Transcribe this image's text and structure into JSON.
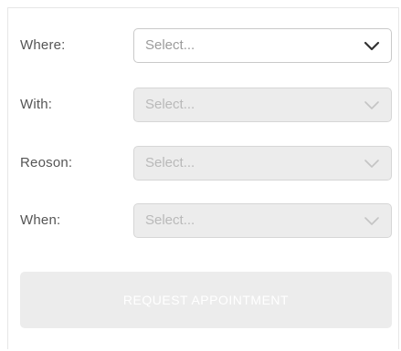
{
  "form": {
    "where": {
      "label": "Where:",
      "value": "Select...",
      "enabled": true
    },
    "with": {
      "label": "With:",
      "value": "Select...",
      "enabled": false
    },
    "reason": {
      "label": "Reoson:",
      "value": "Select...",
      "enabled": false
    },
    "when": {
      "label": "When:",
      "value": "Select...",
      "enabled": false
    },
    "submit_label": "REQUEST APPOINTMENT"
  },
  "icons": {
    "dropdown": "chevron-down-icon"
  },
  "colors": {
    "enabled_chevron": "#333333",
    "disabled_chevron": "#c4c4c4",
    "disabled_bg": "#ececec"
  }
}
